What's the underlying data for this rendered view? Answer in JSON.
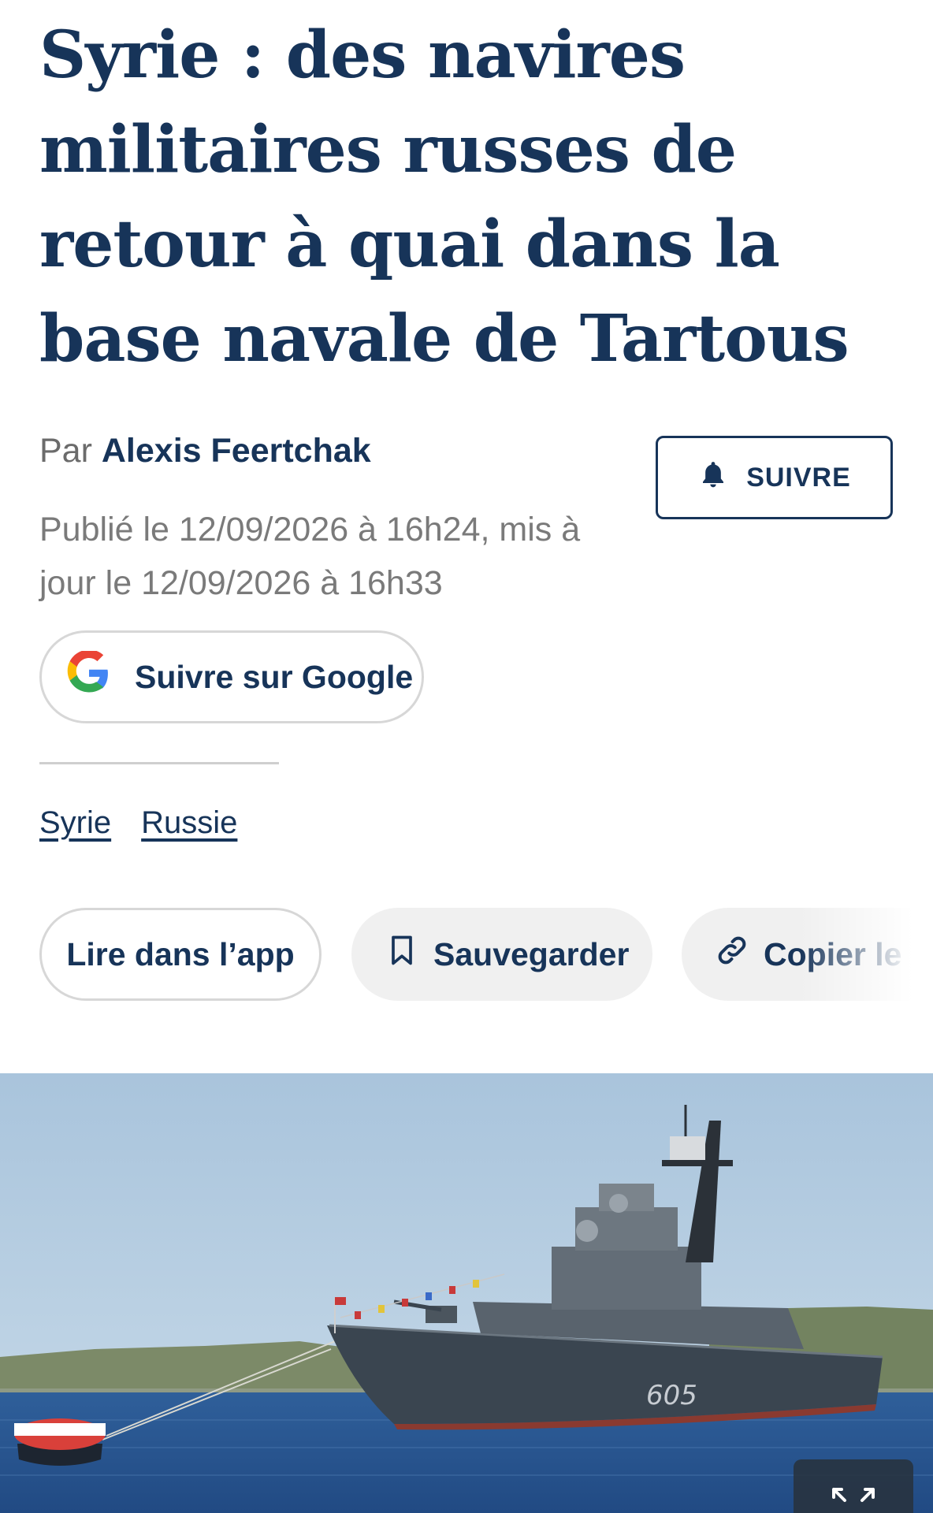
{
  "article": {
    "title": "Syrie : des navires militaires russes de retour à quai dans la base navale de Tartous",
    "byline_prefix": "Par ",
    "author": "Alexis Feertchak",
    "dates": "Publié le 12/09/2026 à 16h24, mis à jour le 12/09/2026 à 16h33"
  },
  "follow_button": {
    "label": "SUIVRE",
    "icon": "bell-icon"
  },
  "google_button": {
    "label": "Suivre sur Google",
    "icon": "google-g-icon"
  },
  "tags": [
    "Syrie",
    "Russie"
  ],
  "actions": {
    "read_in_app": "Lire dans l’app",
    "save": "Sauvegarder",
    "copy_link": "Copier le lien"
  },
  "hero_image": {
    "description_icon": "expand-icon",
    "hull_number": "605"
  },
  "colors": {
    "brand_navy": "#173459",
    "meta_gray": "#7a7a7a",
    "chip_bg": "#f0f0f0"
  }
}
